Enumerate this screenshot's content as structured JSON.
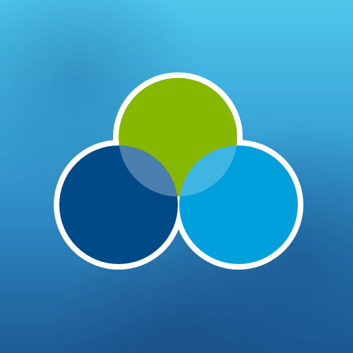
{
  "icon": {
    "name": "three-overlapping-circles-logo",
    "background": {
      "style": "blurred-blue-gradient",
      "colors": [
        "#4ec7ea",
        "#3aa6d8",
        "#2a7fb9",
        "#1d5b94"
      ]
    },
    "circles": [
      {
        "name": "top-circle",
        "color": "#86b800"
      },
      {
        "name": "left-circle",
        "color": "#004a87"
      },
      {
        "name": "right-circle",
        "color": "#00a0dd"
      }
    ],
    "outline_color": "#ffffff"
  }
}
